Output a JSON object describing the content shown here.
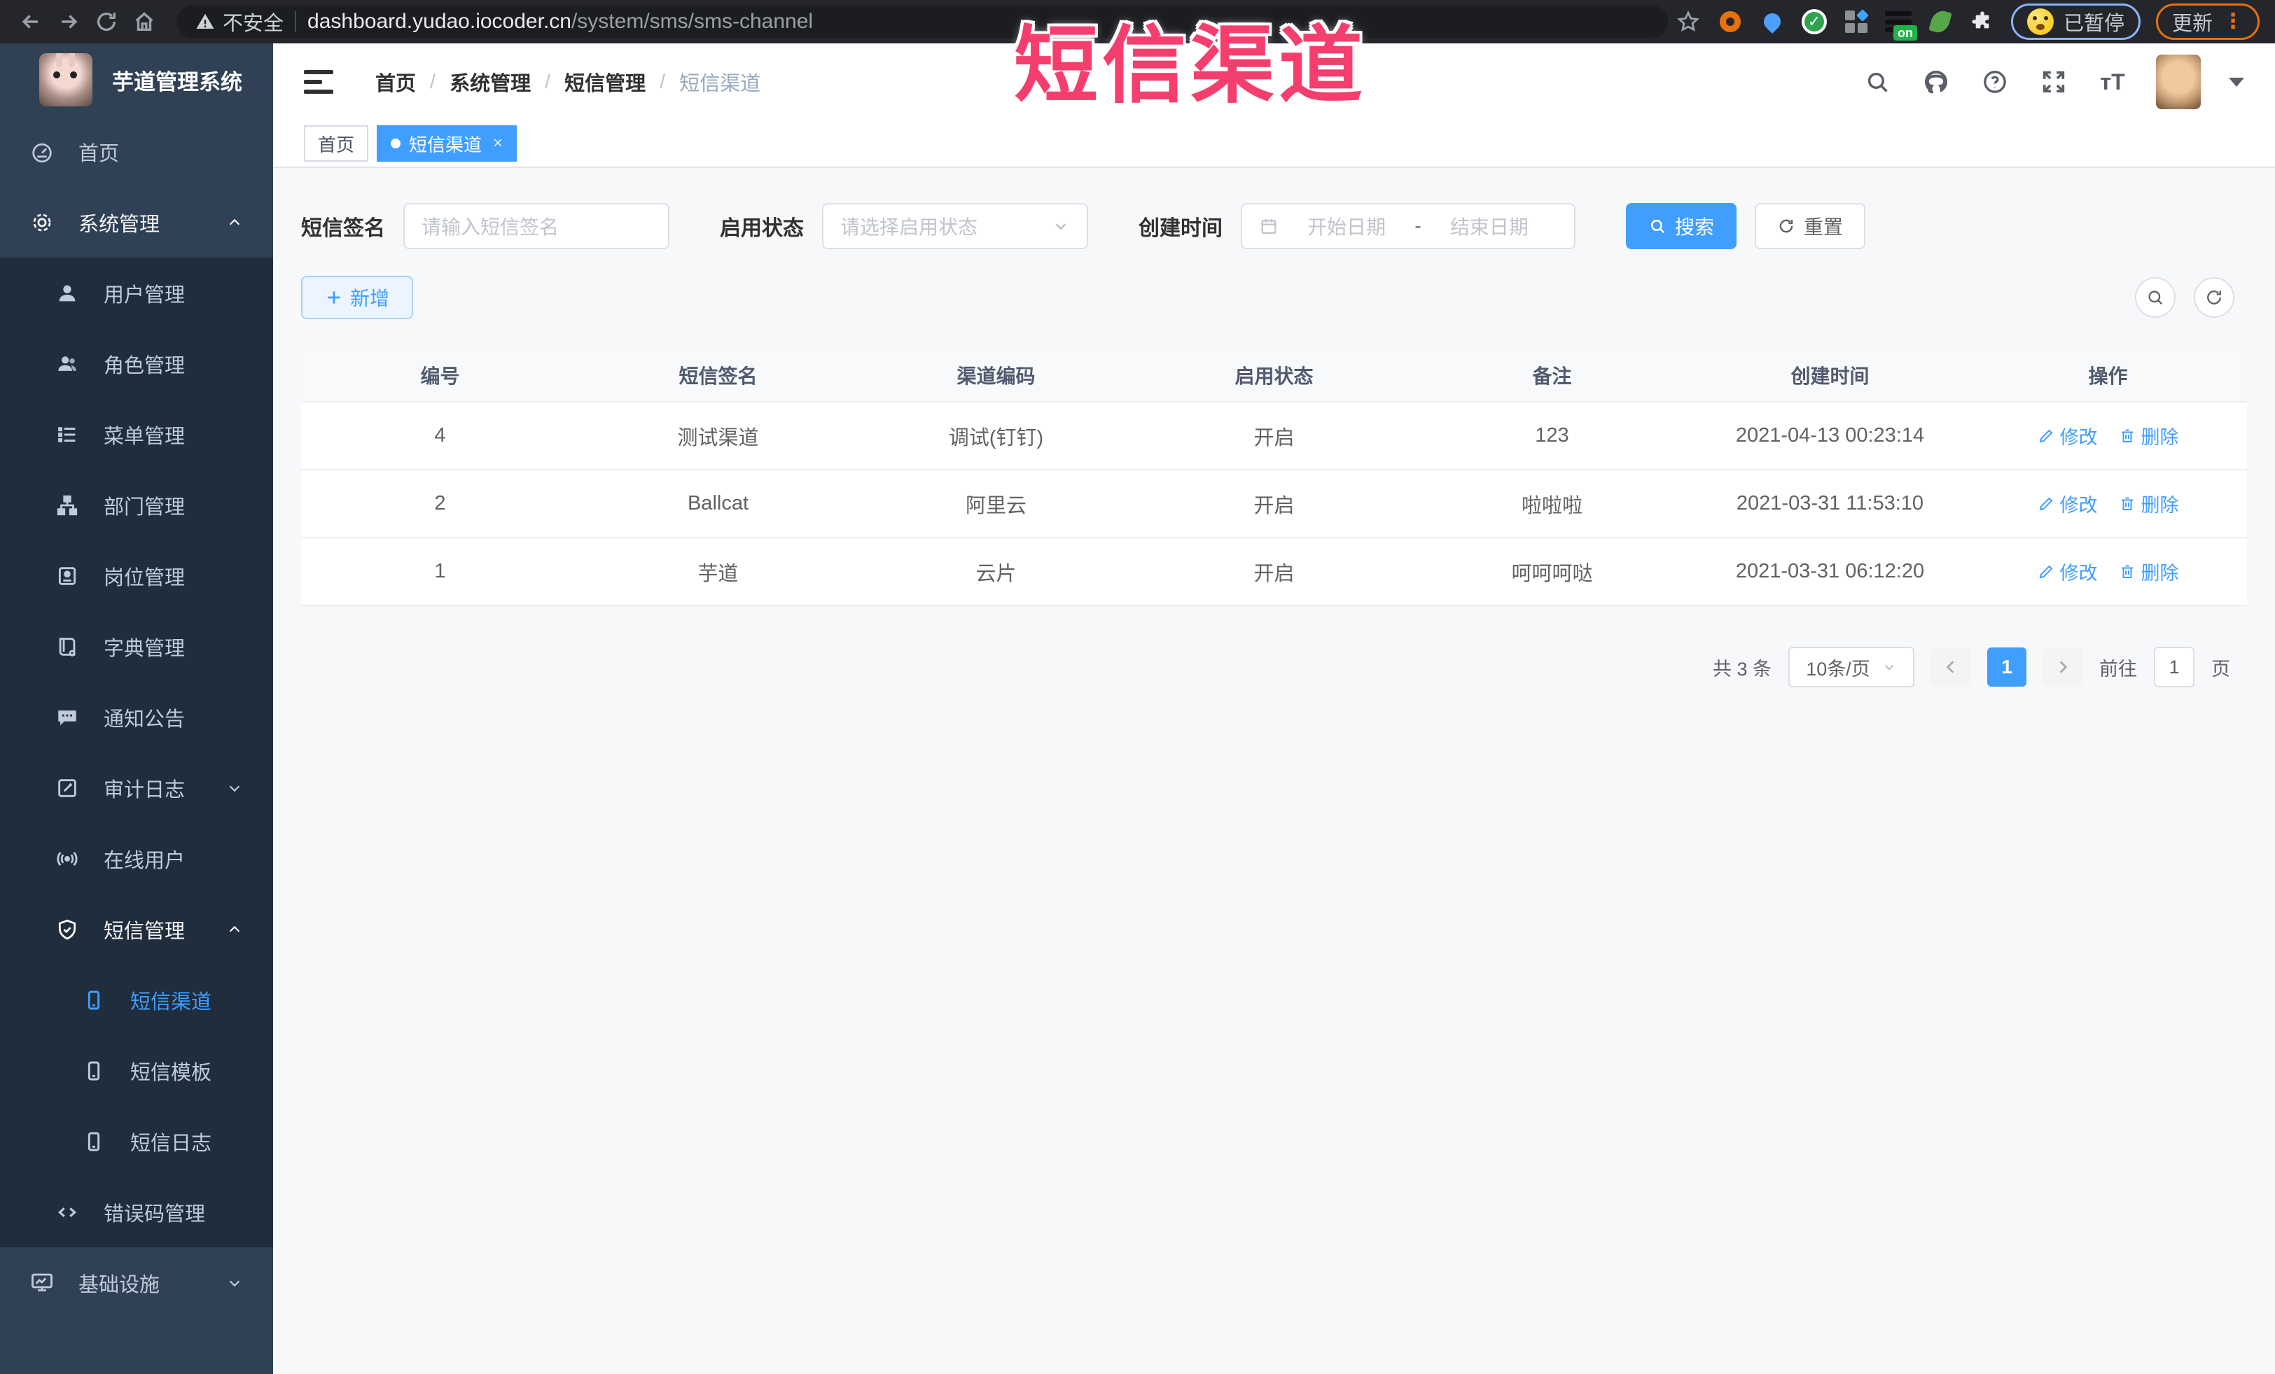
{
  "browser": {
    "security_label": "不安全",
    "url_domain": "dashboard.yudao.iocoder.cn",
    "url_path": "/system/sms/sms-channel",
    "on_badge": "on",
    "paused_label": "已暂停",
    "update_label": "更新"
  },
  "watermark": "短信渠道",
  "sidebar": {
    "title": "芋道管理系统",
    "items": [
      {
        "label": "首页"
      },
      {
        "label": "系统管理"
      },
      {
        "label": "用户管理"
      },
      {
        "label": "角色管理"
      },
      {
        "label": "菜单管理"
      },
      {
        "label": "部门管理"
      },
      {
        "label": "岗位管理"
      },
      {
        "label": "字典管理"
      },
      {
        "label": "通知公告"
      },
      {
        "label": "审计日志"
      },
      {
        "label": "在线用户"
      },
      {
        "label": "短信管理"
      },
      {
        "label": "短信渠道"
      },
      {
        "label": "短信模板"
      },
      {
        "label": "短信日志"
      },
      {
        "label": "错误码管理"
      },
      {
        "label": "基础设施"
      }
    ]
  },
  "breadcrumb": {
    "items": [
      "首页",
      "系统管理",
      "短信管理",
      "短信渠道"
    ],
    "separator": "/"
  },
  "tabs": [
    {
      "label": "首页"
    },
    {
      "label": "短信渠道",
      "close": "×"
    }
  ],
  "filters": {
    "signature_label": "短信签名",
    "signature_placeholder": "请输入短信签名",
    "status_label": "启用状态",
    "status_placeholder": "请选择启用状态",
    "time_label": "创建时间",
    "start_placeholder": "开始日期",
    "range_separator": "-",
    "end_placeholder": "结束日期",
    "search_label": "搜索",
    "reset_label": "重置"
  },
  "toolbar": {
    "add_label": "新增"
  },
  "table": {
    "headers": [
      "编号",
      "短信签名",
      "渠道编码",
      "启用状态",
      "备注",
      "创建时间",
      "操作"
    ],
    "edit_label": "修改",
    "delete_label": "删除",
    "rows": [
      {
        "id": "4",
        "signature": "测试渠道",
        "code": "调试(钉钉)",
        "status": "开启",
        "remark": "123",
        "created": "2021-04-13 00:23:14"
      },
      {
        "id": "2",
        "signature": "Ballcat",
        "code": "阿里云",
        "status": "开启",
        "remark": "啦啦啦",
        "created": "2021-03-31 11:53:10"
      },
      {
        "id": "1",
        "signature": "芋道",
        "code": "云片",
        "status": "开启",
        "remark": "呵呵呵哒",
        "created": "2021-03-31 06:12:20"
      }
    ]
  },
  "pagination": {
    "total_label": "共 3 条",
    "page_size_label": "10条/页",
    "current_page": "1",
    "goto_label": "前往",
    "goto_value": "1",
    "page_unit": "页"
  },
  "colors": {
    "accent": "#409EFF",
    "sidebar_bg": "#304156",
    "submenu_bg": "#1f2d3d",
    "watermark_pink": "#f43f6e",
    "add_button_bg": "#ecf5ff"
  }
}
